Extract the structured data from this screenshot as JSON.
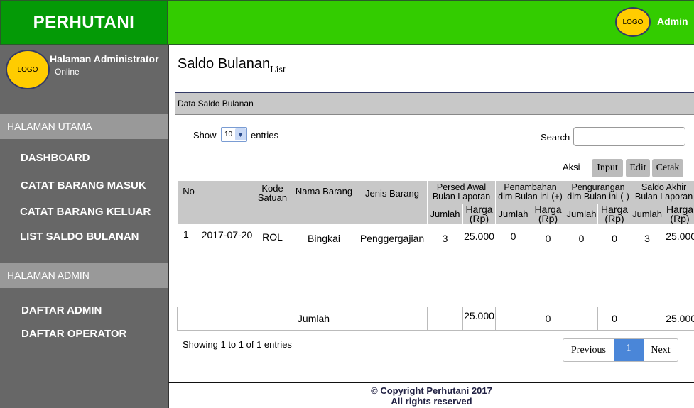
{
  "brand": "PERHUTANI",
  "logo_text": "LOGO",
  "user": {
    "name": "Halaman Administrator",
    "status": "Online"
  },
  "topbar": {
    "user_label": "Admin"
  },
  "sidebar": {
    "sections": [
      {
        "header": "HALAMAN UTAMA",
        "items": [
          "DASHBOARD",
          "CATAT BARANG MASUK",
          "CATAT BARANG KELUAR",
          "LIST SALDO BULANAN"
        ]
      },
      {
        "header": "HALAMAN ADMIN",
        "items": [
          "DAFTAR ADMIN",
          "DAFTAR OPERATOR"
        ]
      }
    ]
  },
  "page": {
    "title": "Saldo Bulanan",
    "subtitle": "List"
  },
  "panel": {
    "title": "Data Saldo Bulanan",
    "show_label": "Show",
    "page_size": "10",
    "entries_label": "entries",
    "search_label": "Search",
    "search_value": "",
    "aksi_label": "Aksi",
    "actions": [
      "Input",
      "Edit",
      "Cetak"
    ]
  },
  "table": {
    "headers": {
      "no": "No",
      "kode_satuan": "Kode Satuan",
      "nama_barang": "Nama Barang",
      "jenis_barang": "Jenis Barang",
      "groups": [
        "Persed Awal Bulan Laporan",
        "Penambahan dlm Bulan ini (+)",
        "Pengurangan dlm Bulan ini (-)",
        "Saldo Akhir Bulan Laporan"
      ],
      "jumlah": "Jumlah",
      "harga": "Harga (Rp)"
    },
    "rows": [
      {
        "no": "1",
        "tanggal": "2017-07-20",
        "kode": "ROL",
        "nama": "Bingkai",
        "jenis": "Penggergajian",
        "values": [
          "3",
          "25.000",
          "0",
          "0",
          "0",
          "0",
          "3",
          "25.000"
        ]
      }
    ],
    "footer": {
      "label": "Jumlah",
      "values": [
        "",
        "25.000",
        "",
        "0",
        "",
        "0",
        "",
        "25.000"
      ]
    }
  },
  "info": "Showing 1 to 1 of 1 entries",
  "pagination": {
    "previous": "Previous",
    "current": "1",
    "next": "Next"
  },
  "footer": {
    "line1": "© Copyright Perhutani 2017",
    "line2": "All rights reserved"
  },
  "colors": {
    "brand_green": "#049a06",
    "top_green": "#33cc00",
    "sidebar_gray": "#676767",
    "logo_yellow": "#ffcc00",
    "active_page": "#4a86d8"
  }
}
